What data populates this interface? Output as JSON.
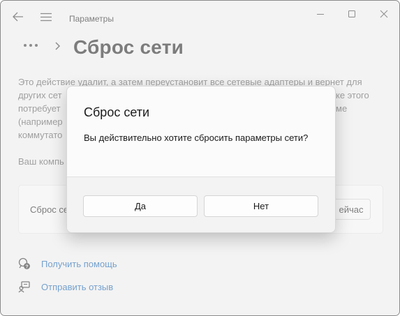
{
  "window": {
    "title": "Параметры",
    "icons": {
      "back": "back-arrow-icon",
      "menu": "hamburger-menu-icon",
      "minimize": "minimize-icon",
      "maximize": "maximize-icon",
      "close": "close-icon"
    }
  },
  "page": {
    "breadcrumb_more": "more-icon",
    "breadcrumb_chevron": "chevron-right-icon",
    "title": "Сброс сети",
    "description_lines": [
      "Это действие удалит, а затем переустановит все сетевые адаптеры и вернет для",
      "других сет",
      "потребует",
      "(например",
      "коммутато"
    ],
    "description_right_fragments": [
      "ке этого",
      "ме"
    ],
    "computer_line": "Ваш компь",
    "card": {
      "label": "Сброс се",
      "button_label": "ейчас"
    },
    "links": [
      {
        "icon": "help-icon",
        "label": "Получить помощь"
      },
      {
        "icon": "feedback-icon",
        "label": "Отправить отзыв"
      }
    ]
  },
  "dialog": {
    "title": "Сброс сети",
    "message": "Вы действительно хотите сбросить параметры сети?",
    "yes_label": "Да",
    "no_label": "Нет"
  },
  "colors": {
    "accent_link": "#0b5cad",
    "window_bg": "#f3f3f3",
    "dialog_bg": "#fbfbfb"
  }
}
